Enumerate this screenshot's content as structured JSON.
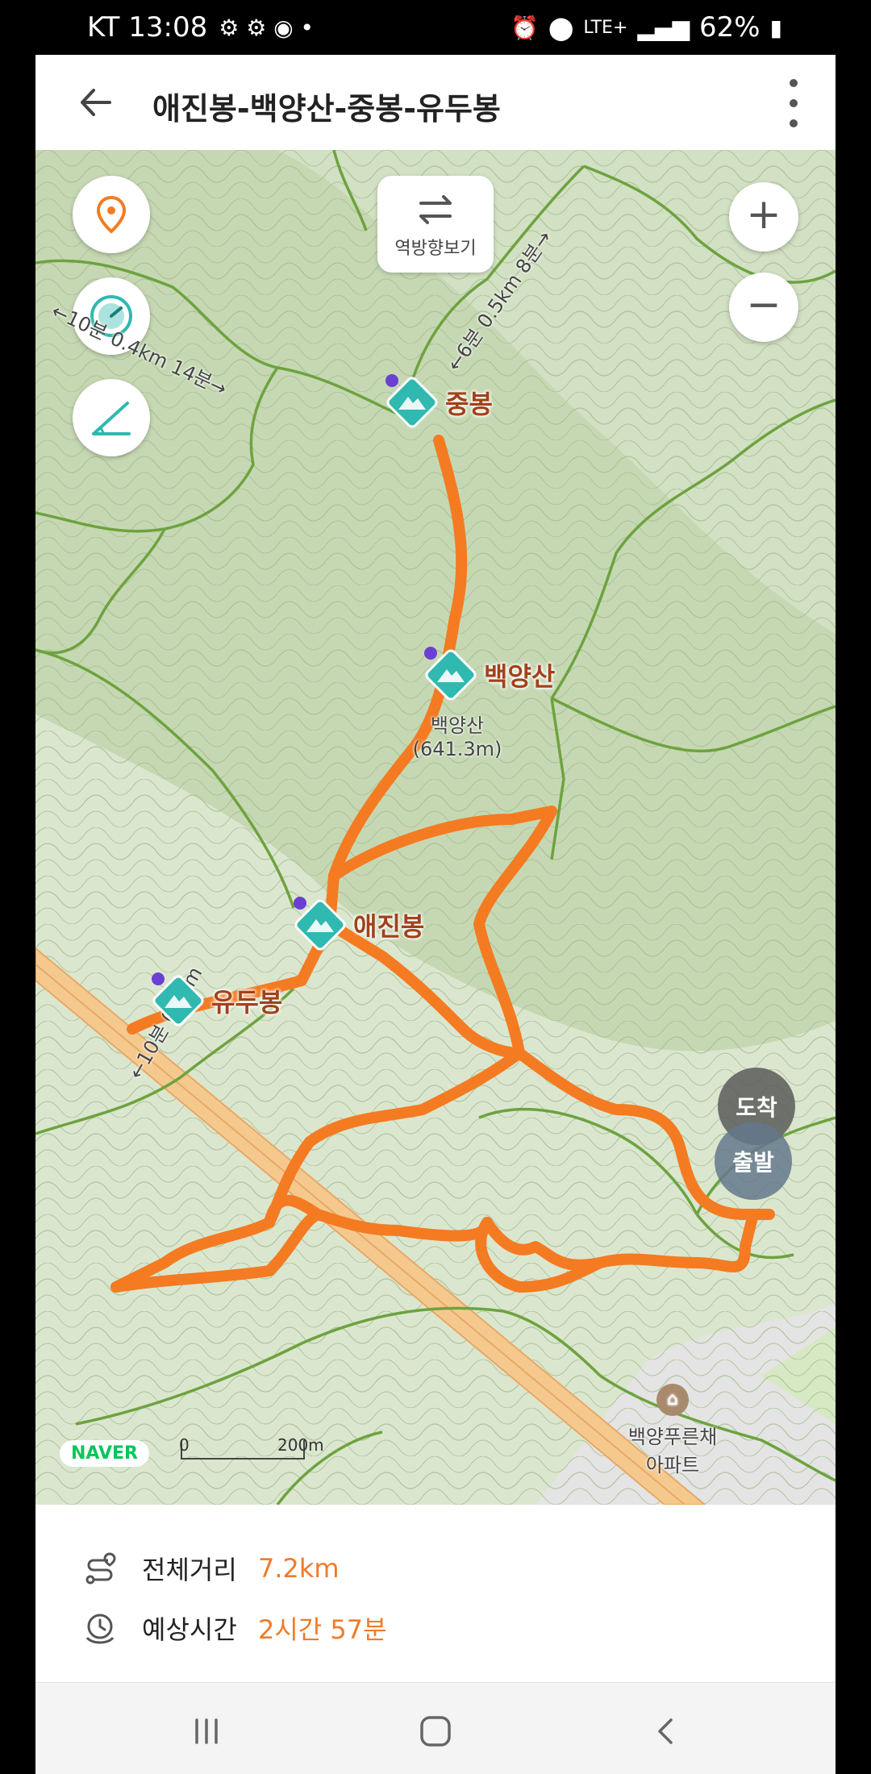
{
  "status_bar": {
    "carrier_time": "KT 13:08",
    "network": "LTE+",
    "battery": "62%"
  },
  "header": {
    "title": "애진봉-백양산-중봉-유두봉"
  },
  "map": {
    "reverse_button_label": "역방향보기",
    "peaks": {
      "jungbong": "중봉",
      "baegyangsan": "백양산",
      "aejinbong": "애진봉",
      "yudubong": "유두봉"
    },
    "summit_label_name": "백양산",
    "summit_label_height": "(641.3m)",
    "trail_label_1": "←10분 0.4km 14분→",
    "trail_label_2": "←6분 0.5km 8분→",
    "trail_label_3": "←10분 0.4km",
    "arrival_pin": "도착",
    "departure_pin": "출발",
    "apartment_name_line1": "백양푸른채",
    "apartment_name_line2": "아파트",
    "brand": "NAVER",
    "scale_zero": "0",
    "scale_distance": "200m",
    "colors": {
      "route": "#f47b22",
      "accent": "#2fb9b0"
    }
  },
  "info": {
    "distance_label": "전체거리",
    "distance_value": "7.2km",
    "time_label": "예상시간",
    "time_value": "2시간 57분"
  }
}
